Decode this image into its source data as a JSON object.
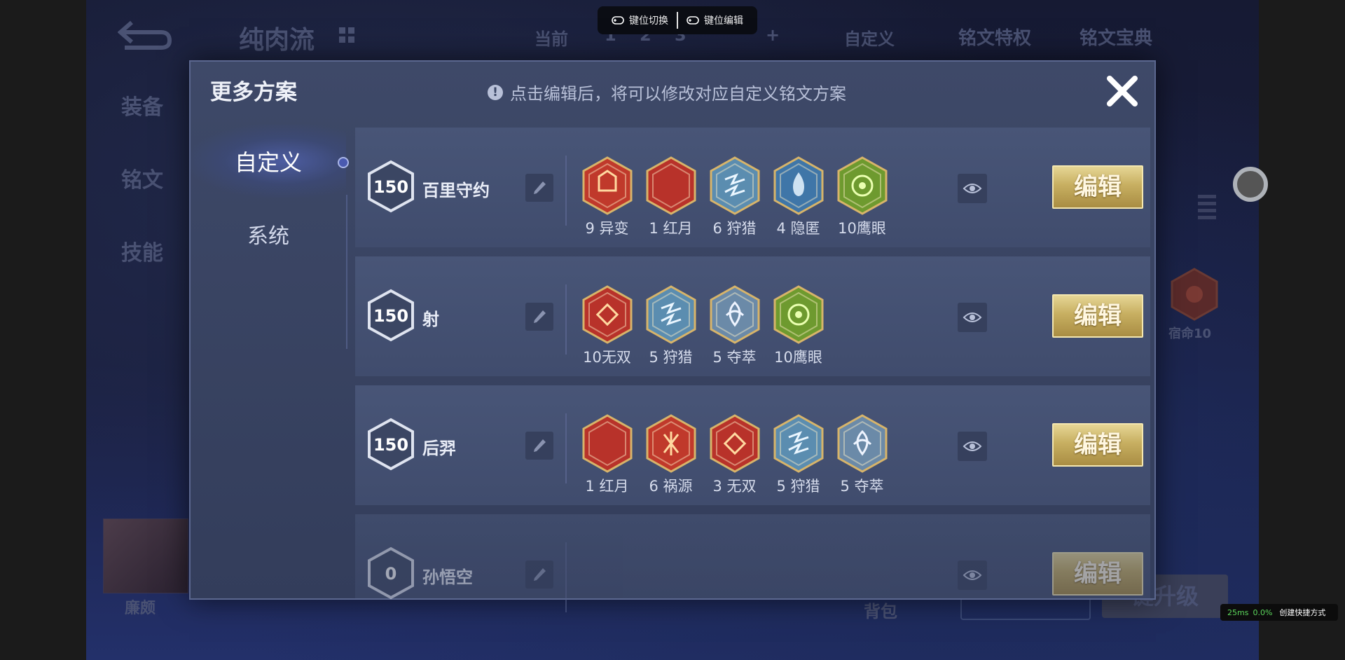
{
  "background": {
    "title": "纯肉流",
    "current_label": "当前",
    "slots": [
      "1",
      "2",
      "3"
    ],
    "add_label": "+",
    "custom_label": "自定义",
    "privilege_label": "铭文特权",
    "dictionary_label": "铭文宝典",
    "side_tabs": [
      "装备",
      "铭文",
      "技能"
    ],
    "hero_name": "廉颇",
    "bag_label": "背包",
    "upgrade_label": "键升级",
    "side_rune_label": "宿命10"
  },
  "toolbar": {
    "switch_label": "键位切换",
    "edit_label": "键位编辑"
  },
  "status": {
    "latency": "25ms",
    "percent": "0.0%",
    "shortcut_label": "创建快捷方式"
  },
  "modal": {
    "title": "更多方案",
    "hint": "点击编辑后，将可以修改对应自定义铭文方案",
    "nav": [
      "自定义",
      "系统"
    ],
    "edit_label": "编辑",
    "presets": [
      {
        "level": "150",
        "name": "百里守约",
        "runes": [
          {
            "label": "9 异变",
            "color": "#c0392b",
            "icon": "mutation-rune-icon"
          },
          {
            "label": "1 红月",
            "color": "#b8322a",
            "icon": "red-moon-rune-icon"
          },
          {
            "label": "6 狩猎",
            "color": "#5b8db0",
            "icon": "hunt-rune-icon"
          },
          {
            "label": "4 隐匿",
            "color": "#3f76a8",
            "icon": "stealth-rune-icon"
          },
          {
            "label": "10鹰眼",
            "color": "#6e9a2f",
            "icon": "hawk-eye-rune-icon"
          }
        ]
      },
      {
        "level": "150",
        "name": "射",
        "runes": [
          {
            "label": "10无双",
            "color": "#b8322a",
            "icon": "peerless-rune-icon"
          },
          {
            "label": "5 狩猎",
            "color": "#5b8db0",
            "icon": "hunt-rune-icon"
          },
          {
            "label": "5 夺萃",
            "color": "#6b8aa8",
            "icon": "plunder-rune-icon"
          },
          {
            "label": "10鹰眼",
            "color": "#6e9a2f",
            "icon": "hawk-eye-rune-icon"
          }
        ]
      },
      {
        "level": "150",
        "name": "后羿",
        "runes": [
          {
            "label": "1 红月",
            "color": "#b8322a",
            "icon": "red-moon-rune-icon"
          },
          {
            "label": "6 祸源",
            "color": "#c0392b",
            "icon": "calamity-rune-icon"
          },
          {
            "label": "3 无双",
            "color": "#b8322a",
            "icon": "peerless-rune-icon"
          },
          {
            "label": "5 狩猎",
            "color": "#5b8db0",
            "icon": "hunt-rune-icon"
          },
          {
            "label": "5 夺萃",
            "color": "#6b8aa8",
            "icon": "plunder-rune-icon"
          }
        ]
      },
      {
        "level": "0",
        "name": "孙悟空",
        "runes": []
      }
    ]
  }
}
